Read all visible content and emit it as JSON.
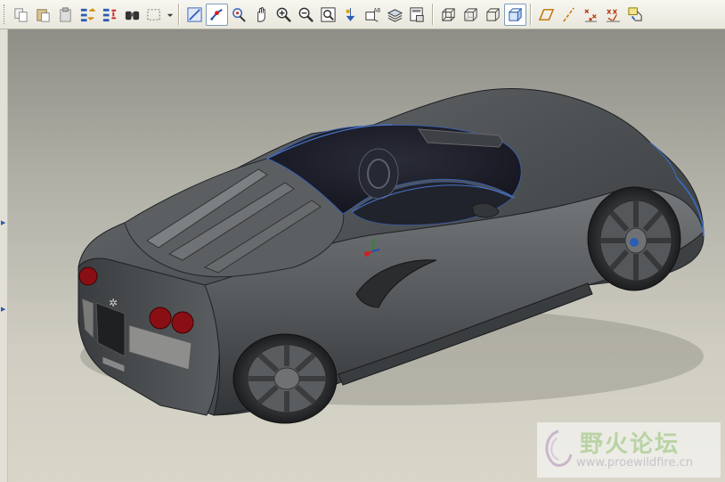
{
  "toolbar": {
    "groups": [
      [
        "copy-icon",
        "paste-icon",
        "paste-special-icon",
        "regenerate-icon",
        "regenerate-manager-icon",
        "find-icon",
        "selection-box-icon"
      ],
      [
        "repaint-icon",
        "spin-center-icon",
        "orient-mode-icon",
        "pan-icon",
        "zoom-in-icon",
        "zoom-out-icon",
        "refit-icon",
        "datum-display-icon",
        "annotation-display-icon",
        "layers-icon",
        "model-tree-icon"
      ],
      [
        "wireframe-icon",
        "hidden-line-icon",
        "no-hidden-icon",
        "shading-icon"
      ],
      [
        "datum-planes-icon",
        "datum-axes-icon",
        "datum-points-icon",
        "csys-icon",
        "show-feature-icon"
      ]
    ],
    "pressed": [
      "spin-center-icon",
      "shading-icon"
    ]
  },
  "watermark": {
    "text_cn": "野火论坛",
    "url": "www.proewildfire.cn"
  },
  "colors": {
    "toolbar_bg": "#ebe9df",
    "viewport_top": "#8e8e87",
    "viewport_bottom": "#d9d6c9",
    "car_body": "#55595c",
    "taillight": "#8a0f14"
  }
}
